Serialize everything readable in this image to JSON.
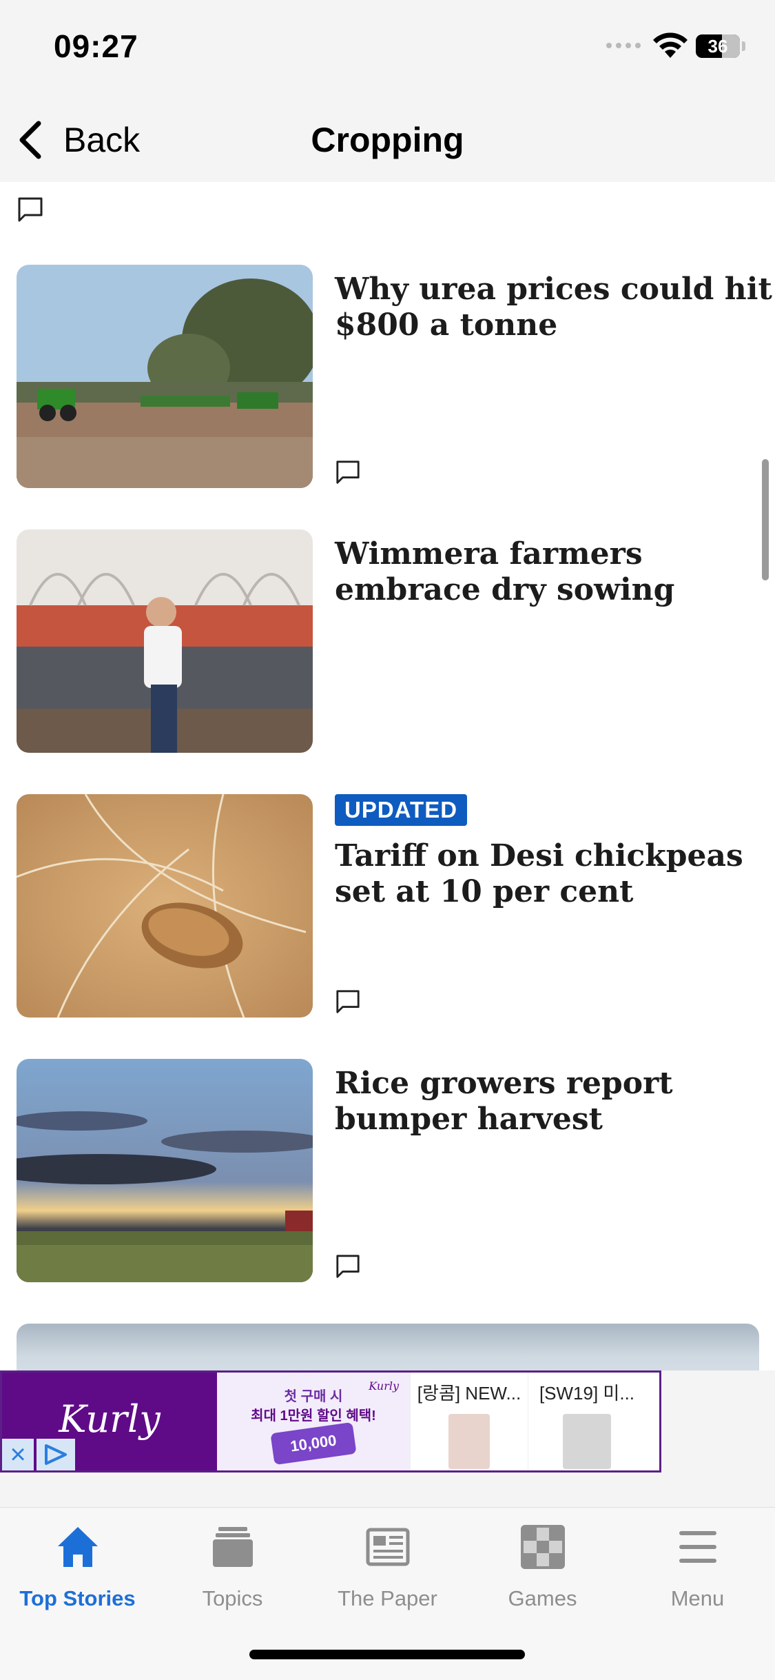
{
  "status_bar": {
    "time": "09:27",
    "battery": "36"
  },
  "nav": {
    "back_label": "Back",
    "title": "Cropping"
  },
  "articles": [
    {
      "headline": "Why urea prices could hit $800 a tonne",
      "badge": ""
    },
    {
      "headline": "Wimmera farmers embrace dry sowing",
      "badge": ""
    },
    {
      "headline": "Tariff on Desi chickpeas set at 10 per cent",
      "badge": "UPDATED"
    },
    {
      "headline": "Rice growers report bumper harvest",
      "badge": ""
    }
  ],
  "ad": {
    "brand": "Kurly",
    "promo_line1": "첫 구매 시",
    "promo_line2": "최대 1만원 할인 혜택!",
    "coupon": "10,000",
    "product1": "[랑콤] NEW...",
    "product2": "[SW19] 미..."
  },
  "tabs": [
    {
      "label": "Top Stories",
      "icon": "house-icon",
      "active": true
    },
    {
      "label": "Topics",
      "icon": "stack-icon",
      "active": false
    },
    {
      "label": "The Paper",
      "icon": "newspaper-icon",
      "active": false
    },
    {
      "label": "Games",
      "icon": "checkerboard-icon",
      "active": false
    },
    {
      "label": "Menu",
      "icon": "hamburger-icon",
      "active": false
    }
  ],
  "colors": {
    "accent": "#1d6fd8",
    "badge": "#0f5cc0",
    "ad_brand": "#5f0b87"
  }
}
